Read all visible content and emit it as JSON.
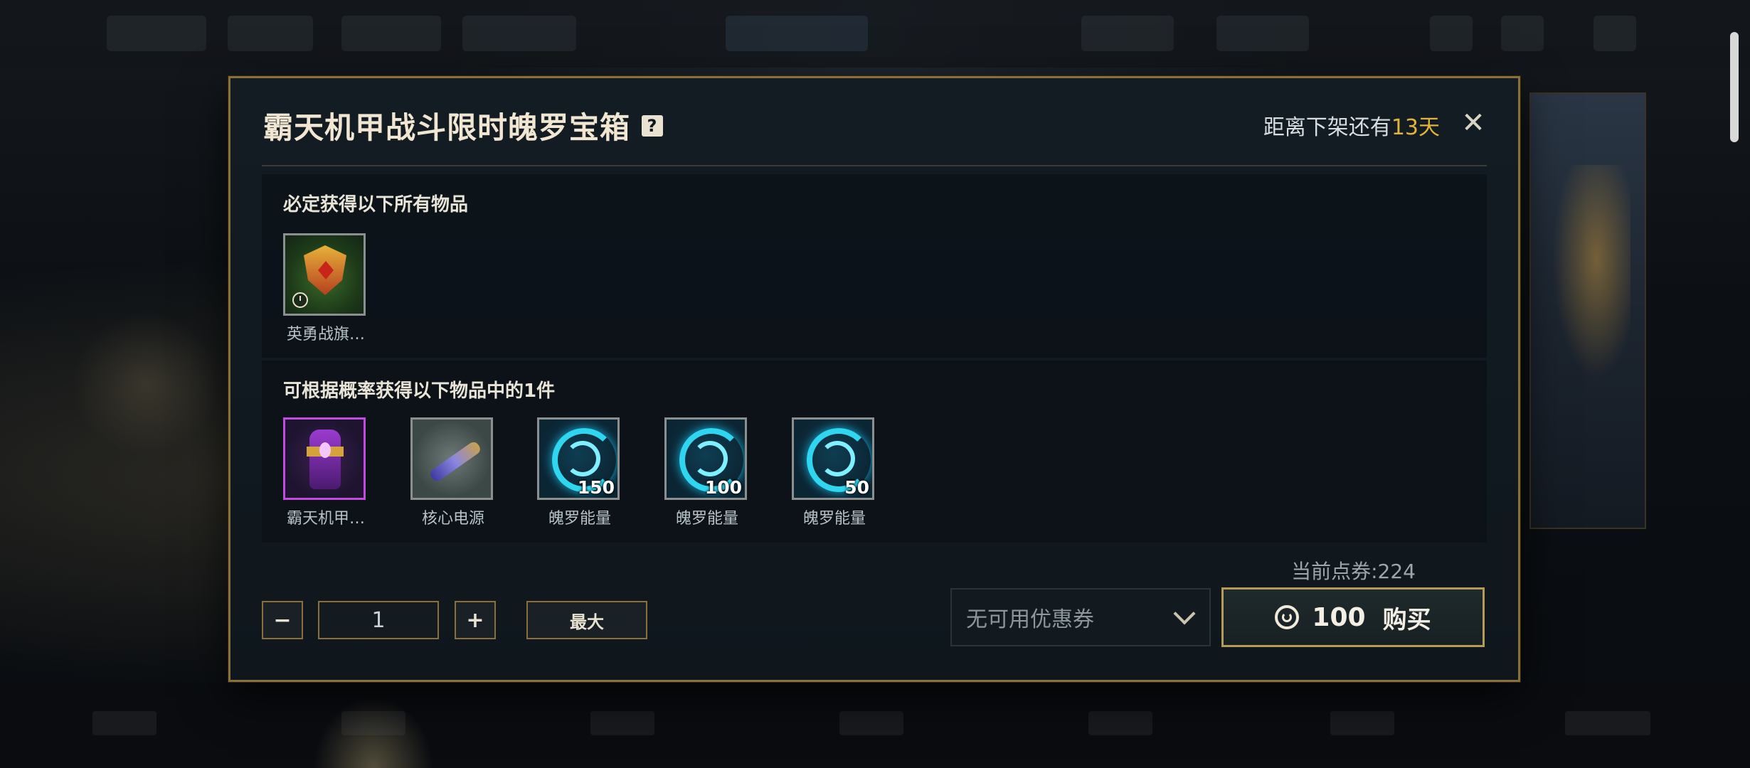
{
  "modal": {
    "title": "霸天机甲战斗限时魄罗宝箱",
    "help_icon": "question-mark-icon",
    "countdown_prefix": "距离下架还有",
    "countdown_days": "13天",
    "close_icon": "close-x-icon"
  },
  "guaranteed": {
    "title": "必定获得以下所有物品",
    "items": [
      {
        "label": "英勇战旗…",
        "icon": "banner-icon"
      }
    ]
  },
  "random": {
    "title": "可根据概率获得以下物品中的1件",
    "items": [
      {
        "label": "霸天机甲…",
        "icon": "lantern-icon",
        "qty": ""
      },
      {
        "label": "核心电源",
        "icon": "core-power-icon",
        "qty": ""
      },
      {
        "label": "魄罗能量",
        "icon": "poro-energy-icon",
        "qty": "150"
      },
      {
        "label": "魄罗能量",
        "icon": "poro-energy-icon",
        "qty": "100"
      },
      {
        "label": "魄罗能量",
        "icon": "poro-energy-icon",
        "qty": "50"
      }
    ]
  },
  "controls": {
    "minus_label": "−",
    "quantity": "1",
    "plus_label": "+",
    "max_label": "最大",
    "points_text": "当前点券:224",
    "coupon_text": "无可用优惠券",
    "buy_price": "100",
    "buy_label": "购买"
  },
  "colors": {
    "accent_gold": "#8a6f3a",
    "highlight_days": "#e0b33a",
    "rare_purple": "#c24be0"
  }
}
